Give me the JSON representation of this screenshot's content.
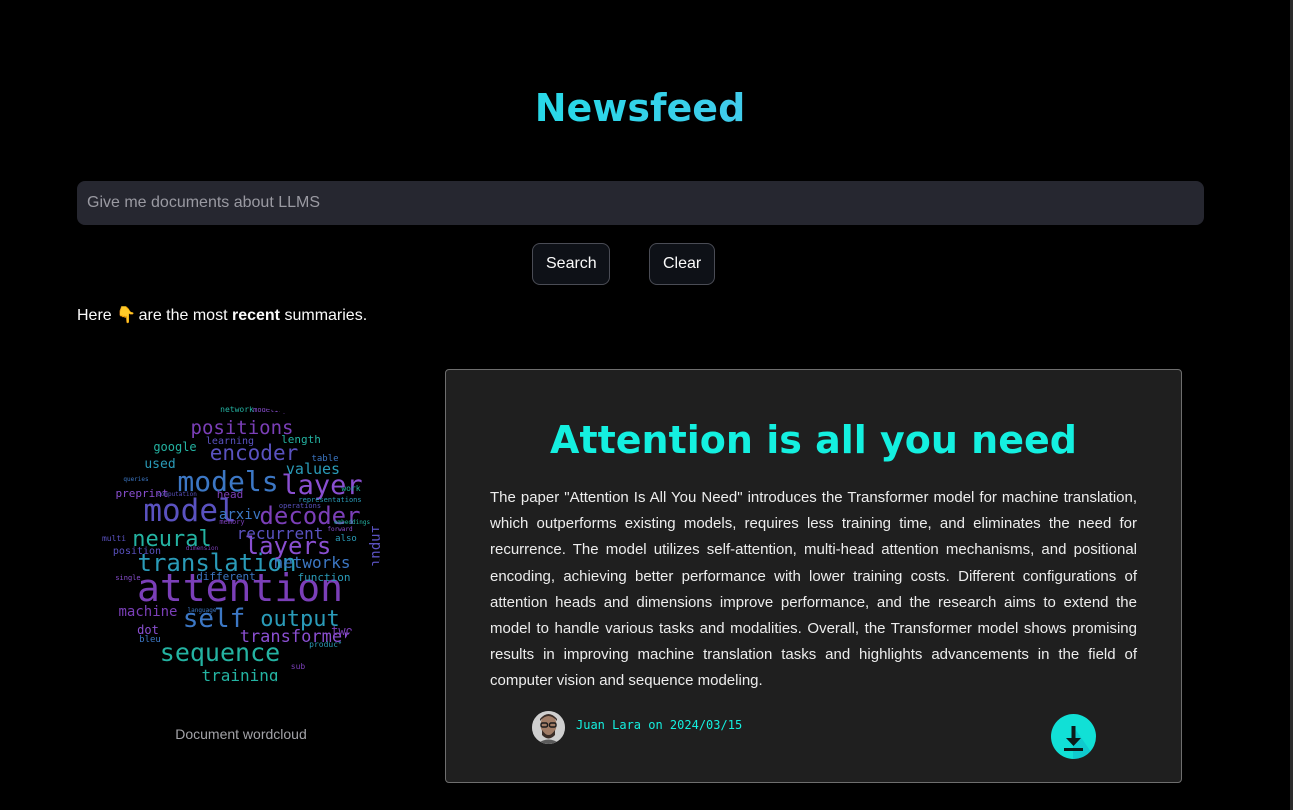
{
  "header": {
    "title": "Newsfeed"
  },
  "search": {
    "placeholder": "Give me documents about LLMS",
    "value": ""
  },
  "buttons": {
    "search_label": "Search",
    "clear_label": "Clear"
  },
  "intro": {
    "prefix": "Here",
    "emoji": "👇",
    "middle": "are the most",
    "emphasis": "recent",
    "suffix": "summaries."
  },
  "wordcloud": {
    "caption": "Document wordcloud",
    "words": [
      "attention",
      "model",
      "models",
      "translation",
      "sequence",
      "layer",
      "decoder",
      "encoder",
      "self",
      "output",
      "neural",
      "layers",
      "positions",
      "recurrent",
      "networks",
      "values",
      "training",
      "transformer",
      "machine",
      "input",
      "arxiv",
      "used",
      "google",
      "preprint",
      "head",
      "learning",
      "different",
      "function",
      "length",
      "dot",
      "two",
      "position",
      "table",
      "also",
      "network",
      "modeling",
      "sub",
      "multi",
      "bleu",
      "product",
      "work",
      "single",
      "memory",
      "operations",
      "language",
      "representations",
      "embeddings",
      "forward",
      "dimension",
      "computation",
      "queries"
    ],
    "colors": [
      "#7b3fb8",
      "#5a52c0",
      "#3c77c4",
      "#2a9bb8",
      "#24b3a2",
      "#8a4fd1"
    ]
  },
  "article": {
    "title": "Attention is all you need",
    "summary": "The paper \"Attention Is All You Need\" introduces the Transformer model for machine translation, which outperforms existing models, requires less training time, and eliminates the need for recurrence. The model utilizes self-attention, multi-head attention mechanisms, and positional encoding, achieving better performance with lower training costs. Different configurations of attention heads and dimensions improve performance, and the research aims to extend the model to handle various tasks and modalities. Overall, the Transformer model shows promising results in improving machine translation tasks and highlights advancements in the field of computer vision and sequence modeling.",
    "byline": "Juan Lara on 2024/03/15"
  },
  "icons": {
    "download": "download-icon",
    "avatar": "avatar",
    "emoji": "pointing-down-icon"
  },
  "colors": {
    "accent": "#14f0e0",
    "background": "#000000",
    "card": "#1f1f1f",
    "input": "#262730"
  }
}
